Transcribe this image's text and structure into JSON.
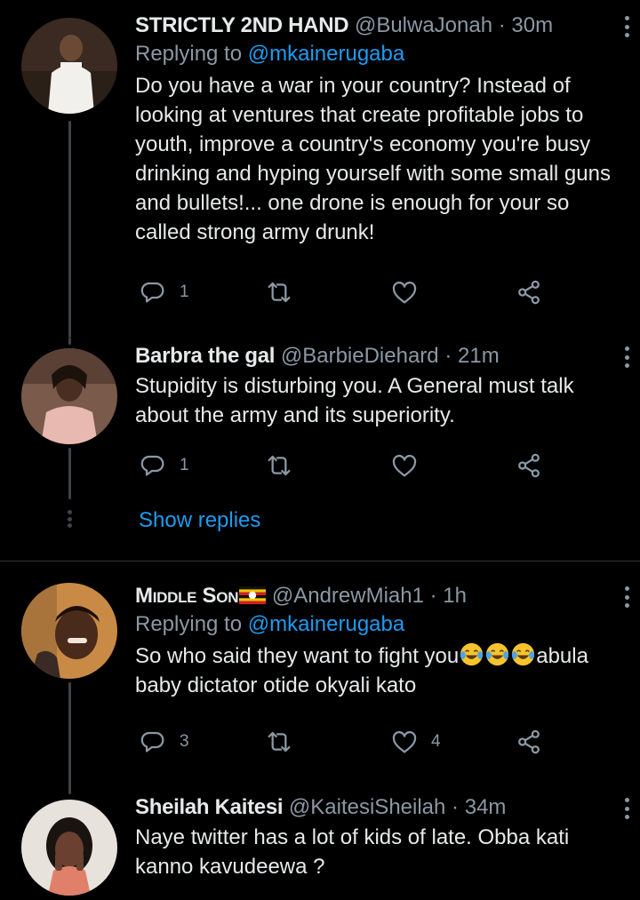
{
  "tweets": [
    {
      "display_name": "STRICTLY 2ND HAND",
      "handle": "@BulwaJonah",
      "separator": "·",
      "time": "30m",
      "replying_prefix": "Replying to",
      "replying_to": "@mkainerugaba",
      "text": "Do you have a war in your country? Instead of looking at ventures that create profitable jobs to youth, improve a country's economy you're busy drinking and hyping yourself with some small guns and bullets!... one drone is enough for your so called strong army drunk!",
      "reply_count": "1",
      "retweet_count": "",
      "like_count": ""
    },
    {
      "display_name": "Barbra the gal",
      "handle": "@BarbieDiehard",
      "separator": "·",
      "time": "21m",
      "text": "Stupidity is disturbing you. A General must talk about the army and its superiority.",
      "reply_count": "1",
      "retweet_count": "",
      "like_count": ""
    },
    {
      "display_name": "Middle Son",
      "handle": "@AndrewMiah1",
      "separator": "·",
      "time": "1h",
      "replying_prefix": "Replying to",
      "replying_to": "@mkainerugaba",
      "text_before_emoji": "So who said they want to fight you",
      "text_after_emoji": "abula baby dictator otide okyali kato",
      "reply_count": "3",
      "retweet_count": "",
      "like_count": "4"
    },
    {
      "display_name": "Sheilah Kaitesi",
      "handle": "@KaitesiSheilah",
      "separator": "·",
      "time": "34m",
      "text": "Naye twitter has a lot of kids of late. Obba kati kanno kavudeewa ?"
    }
  ],
  "show_replies_label": "Show replies",
  "icons": {
    "reply": "reply-icon",
    "retweet": "retweet-icon",
    "like": "heart-icon",
    "share": "share-icon",
    "more": "more-vertical-icon",
    "flag": "uganda-flag-icon",
    "emoji": "tears-of-joy-emoji-icon"
  },
  "colors": {
    "background": "#000000",
    "text_primary": "#e7e9ea",
    "text_secondary": "#8b98a5",
    "accent": "#1d9bf0",
    "thread_line": "#3d4349"
  }
}
